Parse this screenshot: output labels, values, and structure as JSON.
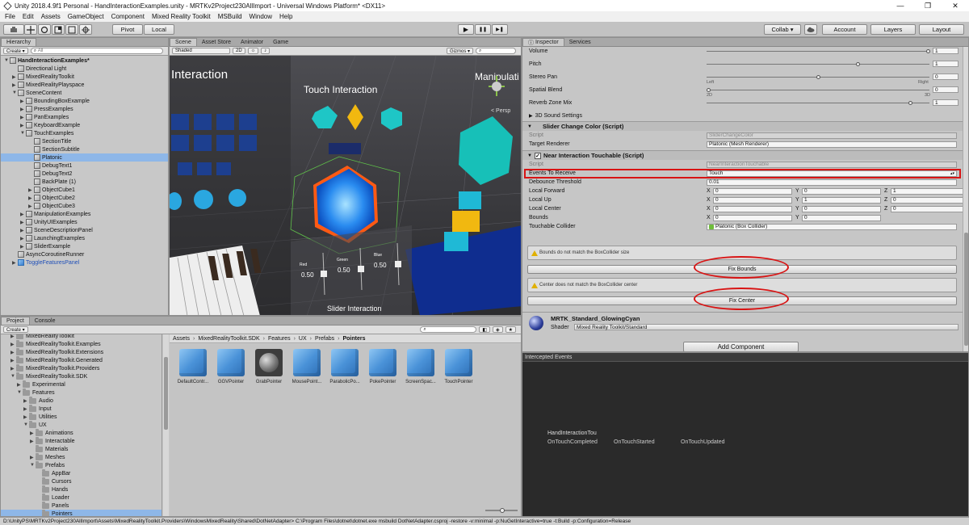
{
  "window": {
    "title": "Unity 2018.4.9f1 Personal - HandInteractionExamples.unity - MRTKv2Project230AllImport - Universal Windows Platform* <DX11>",
    "minimize": "—",
    "maximize": "❐",
    "close": "✕"
  },
  "menu": [
    "File",
    "Edit",
    "Assets",
    "GameObject",
    "Component",
    "Mixed Reality Toolkit",
    "MSBuild",
    "Window",
    "Help"
  ],
  "toolbar": {
    "pivot": "Pivot",
    "local": "Local",
    "play": "▶",
    "pause": "❚❚",
    "step": "▶❚",
    "collab": "Collab ▾",
    "account": "Account",
    "layers": "Layers",
    "layout": "Layout"
  },
  "hierarchy": {
    "tab": "Hierarchy",
    "create": "Create ▾",
    "search_placeholder": "All",
    "items": [
      {
        "label": "HandInteractionExamples*",
        "depth": 0,
        "arrow": "▼",
        "type": "scene"
      },
      {
        "label": "Directional Light",
        "depth": 1,
        "arrow": "",
        "type": "obj"
      },
      {
        "label": "MixedRealityToolkit",
        "depth": 1,
        "arrow": "▶",
        "type": "obj"
      },
      {
        "label": "MixedRealityPlayspace",
        "depth": 1,
        "arrow": "▶",
        "type": "obj"
      },
      {
        "label": "SceneContent",
        "depth": 1,
        "arrow": "▼",
        "type": "obj"
      },
      {
        "label": "BoundingBoxExample",
        "depth": 2,
        "arrow": "▶",
        "type": "obj"
      },
      {
        "label": "PressExamples",
        "depth": 2,
        "arrow": "▶",
        "type": "obj"
      },
      {
        "label": "PanExamples",
        "depth": 2,
        "arrow": "▶",
        "type": "obj"
      },
      {
        "label": "KeyboardExample",
        "depth": 2,
        "arrow": "▶",
        "type": "obj"
      },
      {
        "label": "TouchExamples",
        "depth": 2,
        "arrow": "▼",
        "type": "obj"
      },
      {
        "label": "SectionTitle",
        "depth": 3,
        "arrow": "",
        "type": "obj"
      },
      {
        "label": "SectionSubtitle",
        "depth": 3,
        "arrow": "",
        "type": "obj"
      },
      {
        "label": "Platonic",
        "depth": 3,
        "arrow": "",
        "type": "obj",
        "selected": true
      },
      {
        "label": "DebugText1",
        "depth": 3,
        "arrow": "",
        "type": "obj"
      },
      {
        "label": "DebugText2",
        "depth": 3,
        "arrow": "",
        "type": "obj"
      },
      {
        "label": "BackPlate (1)",
        "depth": 3,
        "arrow": "",
        "type": "obj"
      },
      {
        "label": "ObjectCube1",
        "depth": 3,
        "arrow": "▶",
        "type": "obj"
      },
      {
        "label": "ObjectCube2",
        "depth": 3,
        "arrow": "▶",
        "type": "obj"
      },
      {
        "label": "ObjectCube3",
        "depth": 3,
        "arrow": "▶",
        "type": "obj"
      },
      {
        "label": "ManipulationExamples",
        "depth": 2,
        "arrow": "▶",
        "type": "obj"
      },
      {
        "label": "UnityUIExamples",
        "depth": 2,
        "arrow": "▶",
        "type": "obj"
      },
      {
        "label": "SceneDescriptionPanel",
        "depth": 2,
        "arrow": "▶",
        "type": "obj"
      },
      {
        "label": "LaunchingExamples",
        "depth": 2,
        "arrow": "▶",
        "type": "obj"
      },
      {
        "label": "SliderExample",
        "depth": 2,
        "arrow": "▶",
        "type": "obj"
      },
      {
        "label": "AsyncCoroutineRunner",
        "depth": 1,
        "arrow": "",
        "type": "obj"
      },
      {
        "label": "ToggleFeaturesPanel",
        "depth": 1,
        "arrow": "▶",
        "type": "prefab"
      }
    ]
  },
  "scene": {
    "tabs": [
      "Scene",
      "Asset Store",
      "Animator",
      "Game"
    ],
    "shading": "Shaded",
    "mode_2d": "2D",
    "gizmos": "Gizmos ▾",
    "persp": "< Persp",
    "labels": {
      "interaction_left": "Interaction",
      "touch_interaction": "Touch Interaction",
      "manipulation": "Manipulati",
      "slider_interaction": "Slider Interaction",
      "slider_values": [
        "0.50",
        "0.50",
        "0.50"
      ],
      "slider_names": [
        "Red",
        "Green",
        "Blue"
      ]
    }
  },
  "inspector": {
    "tabs": [
      "Inspector",
      "Services"
    ],
    "audio": [
      {
        "label": "Volume",
        "value": "1",
        "knob": 1.0
      },
      {
        "label": "Pitch",
        "value": "1",
        "knob": 0.68
      },
      {
        "label": "Stereo Pan",
        "value": "0",
        "knob": 0.5,
        "left": "Left",
        "right": "Right"
      },
      {
        "label": "Spatial Blend",
        "value": "0",
        "knob": 0.0,
        "left": "2D",
        "right": "3D"
      },
      {
        "label": "Reverb Zone Mix",
        "value": "1",
        "knob": 0.92
      }
    ],
    "sound_settings": "3D Sound Settings",
    "slider_change_color": {
      "title": "Slider Change Color (Script)",
      "script_label": "Script",
      "script_value": "SliderChangeColor",
      "target_label": "Target Renderer",
      "target_value": "Platonic (Mesh Renderer)"
    },
    "near_touchable": {
      "title": "Near Interaction Touchable (Script)",
      "script_label": "Script",
      "script_value": "NearInteractionTouchable",
      "events_label": "Events To Receive",
      "events_value": "Touch",
      "debounce_label": "Debounce Threshold",
      "debounce_value": "0.01",
      "local_forward_label": "Local Forward",
      "local_forward": [
        "0",
        "0",
        "1"
      ],
      "local_up_label": "Local Up",
      "local_up": [
        "0",
        "1",
        "0"
      ],
      "local_center_label": "Local Center",
      "local_center": [
        "0",
        "0",
        "0"
      ],
      "bounds_label": "Bounds",
      "bounds": [
        "0",
        "0"
      ],
      "collider_label": "Touchable Collider",
      "collider_value": "Platonic (Box Collider)",
      "axis": [
        "X",
        "Y",
        "Z"
      ],
      "warn_bounds": "Bounds do not match the BoxCollider size",
      "fix_bounds": "Fix Bounds",
      "warn_center": "Center does not match the BoxCollider center",
      "fix_center": "Fix Center"
    },
    "material": {
      "name": "MRTK_Standard_GlowingCyan",
      "shader_label": "Shader",
      "shader_value": "Mixed Reality Toolkit/Standard"
    },
    "add_component": "Add Component"
  },
  "intercepted": {
    "title": "Intercepted Events",
    "name": "HandInteractionTou",
    "events": [
      "OnTouchCompleted",
      "OnTouchStarted",
      "OnTouchUpdated"
    ]
  },
  "project": {
    "tabs": [
      "Project",
      "Console"
    ],
    "create": "Create ▾",
    "tree": [
      {
        "label": "MixedRealityToolkit",
        "depth": 1,
        "arrow": "▶"
      },
      {
        "label": "MixedRealityToolkit.Examples",
        "depth": 1,
        "arrow": "▶"
      },
      {
        "label": "MixedRealityToolkit.Extensions",
        "depth": 1,
        "arrow": "▶"
      },
      {
        "label": "MixedRealityToolkit.Generated",
        "depth": 1,
        "arrow": "▶"
      },
      {
        "label": "MixedRealityToolkit.Providers",
        "depth": 1,
        "arrow": "▶"
      },
      {
        "label": "MixedRealityToolkit.SDK",
        "depth": 1,
        "arrow": "▼"
      },
      {
        "label": "Experimental",
        "depth": 2,
        "arrow": "▶"
      },
      {
        "label": "Features",
        "depth": 2,
        "arrow": "▼"
      },
      {
        "label": "Audio",
        "depth": 3,
        "arrow": "▶"
      },
      {
        "label": "Input",
        "depth": 3,
        "arrow": "▶"
      },
      {
        "label": "Utilities",
        "depth": 3,
        "arrow": "▶"
      },
      {
        "label": "UX",
        "depth": 3,
        "arrow": "▼"
      },
      {
        "label": "Animations",
        "depth": 4,
        "arrow": "▶"
      },
      {
        "label": "Interactable",
        "depth": 4,
        "arrow": "▶"
      },
      {
        "label": "Materials",
        "depth": 4,
        "arrow": ""
      },
      {
        "label": "Meshes",
        "depth": 4,
        "arrow": "▶"
      },
      {
        "label": "Prefabs",
        "depth": 4,
        "arrow": "▼"
      },
      {
        "label": "AppBar",
        "depth": 5,
        "arrow": ""
      },
      {
        "label": "Cursors",
        "depth": 5,
        "arrow": ""
      },
      {
        "label": "Hands",
        "depth": 5,
        "arrow": ""
      },
      {
        "label": "Loader",
        "depth": 5,
        "arrow": ""
      },
      {
        "label": "Panels",
        "depth": 5,
        "arrow": ""
      },
      {
        "label": "Pointers",
        "depth": 5,
        "arrow": "",
        "selected": true
      }
    ],
    "breadcrumb": [
      "Assets",
      "MixedRealityToolkit.SDK",
      "Features",
      "UX",
      "Prefabs",
      "Pointers"
    ],
    "assets": [
      {
        "label": "DefaultContr...",
        "kind": "cube"
      },
      {
        "label": "GGVPointer",
        "kind": "cube"
      },
      {
        "label": "GrabPointer",
        "kind": "sphere"
      },
      {
        "label": "MousePoint...",
        "kind": "cube"
      },
      {
        "label": "ParabolicPo...",
        "kind": "cube"
      },
      {
        "label": "PokePointer",
        "kind": "cube"
      },
      {
        "label": "ScreenSpac...",
        "kind": "cube"
      },
      {
        "label": "TouchPointer",
        "kind": "cube"
      }
    ]
  },
  "status": "D:\\UnityPS\\MRTKv2Project230AllImport\\Assets\\MixedRealityToolkit.Providers\\WindowsMixedReality\\Shared\\DotNetAdapter> C:\\Program Files\\dotnet\\dotnet.exe msbuild DotNetAdapter.csproj -restore -v:minimal -p:NuGetInteractive=true -t:Build -p:Configuration=Release"
}
